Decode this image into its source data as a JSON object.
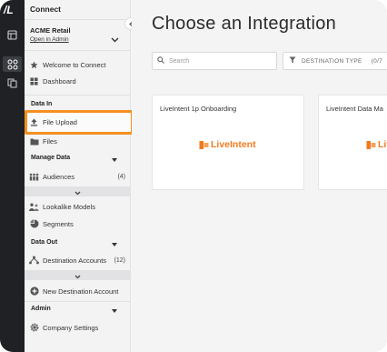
{
  "rail": {
    "logo": "/L"
  },
  "sidebar": {
    "title": "Connect",
    "org_name": "ACME Retail",
    "org_link": "Open in Admin",
    "items_top": [
      {
        "label": "Welcome to Connect",
        "icon": "star-icon"
      },
      {
        "label": "Dashboard",
        "icon": "dashboard-icon"
      }
    ],
    "data_in": {
      "label": "Data In",
      "items": [
        {
          "label": "File Upload",
          "icon": "upload-icon"
        },
        {
          "label": "Files",
          "icon": "folder-icon"
        }
      ]
    },
    "manage_data": {
      "label": "Manage Data",
      "items": [
        {
          "label": "Audiences",
          "count": "(4)",
          "icon": "audiences-icon"
        },
        {
          "label": "Lookalike Models",
          "icon": "lookalike-icon"
        },
        {
          "label": "Segments",
          "icon": "pie-icon"
        }
      ]
    },
    "data_out": {
      "label": "Data Out",
      "items": [
        {
          "label": "Destination Accounts",
          "count": "(12)",
          "icon": "destination-icon"
        },
        {
          "label": "New Destination Account",
          "icon": "plus-circle-icon"
        }
      ]
    },
    "admin": {
      "label": "Admin",
      "items": [
        {
          "label": "Company Settings",
          "icon": "gear-icon"
        }
      ]
    }
  },
  "main": {
    "title": "Choose an Integration",
    "search": {
      "placeholder": "Search"
    },
    "filter": {
      "label": "DESTINATION TYPE",
      "count": "(0/7"
    },
    "cards": [
      {
        "title": "LiveIntent 1p Onboarding",
        "brand": "LiveIntent"
      },
      {
        "title": "LiveIntent Data Ma",
        "brand": "Liv"
      }
    ]
  },
  "colors": {
    "accent_orange": "#f5901e",
    "brand_orange": "#f07a1e",
    "rail": "#1f2124"
  }
}
